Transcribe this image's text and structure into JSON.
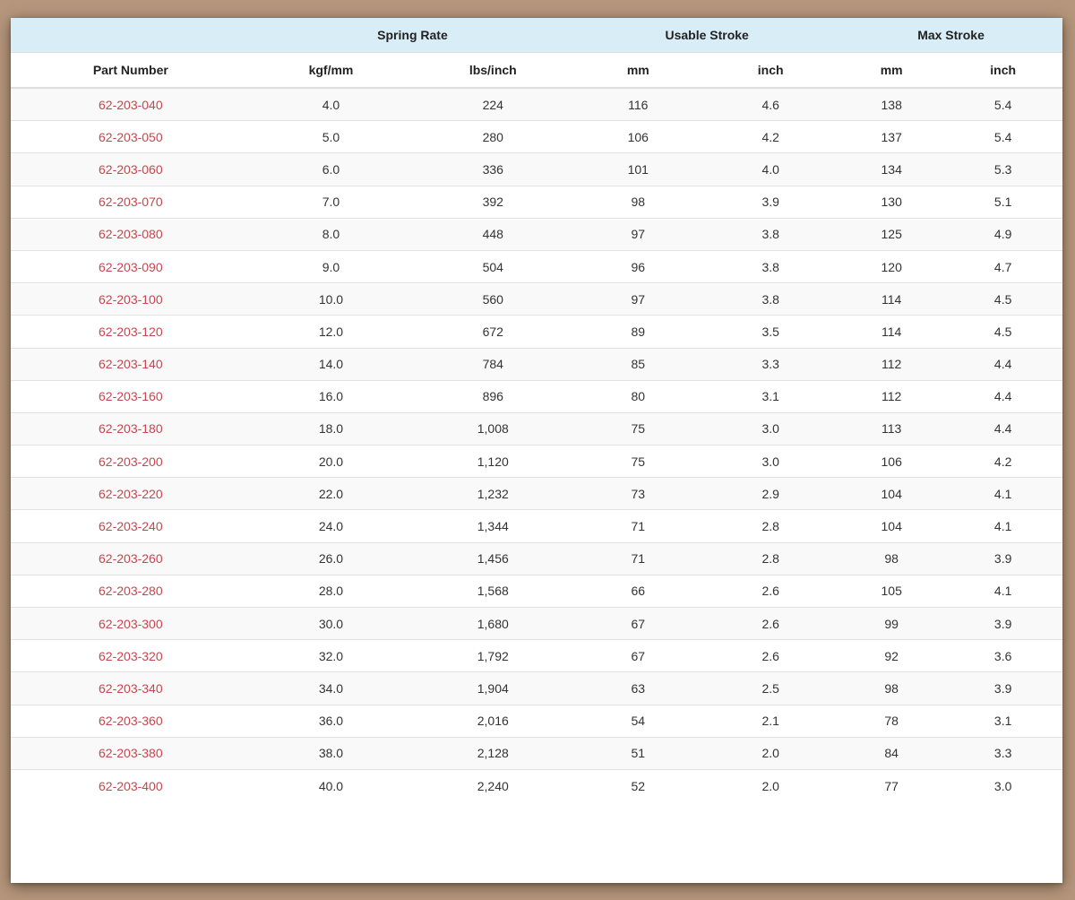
{
  "colors": {
    "page_background": "#b6977d",
    "group_header_bg": "#d9edf7",
    "header_text": "#222222",
    "body_text": "#333333",
    "link_red": "#c7464e",
    "stripe_bg": "#f9f9f9",
    "row_border": "#e2e2e2",
    "head_border": "#dddddd"
  },
  "table": {
    "group_headers": [
      {
        "label": "",
        "colspan": 1
      },
      {
        "label": "Spring Rate",
        "colspan": 2
      },
      {
        "label": "Usable Stroke",
        "colspan": 2
      },
      {
        "label": "Max Stroke",
        "colspan": 2
      }
    ],
    "column_headers": [
      "Part Number",
      "kgf/mm",
      "lbs/inch",
      "mm",
      "inch",
      "mm",
      "inch"
    ],
    "rows": [
      [
        "62-203-040",
        "4.0",
        "224",
        "116",
        "4.6",
        "138",
        "5.4"
      ],
      [
        "62-203-050",
        "5.0",
        "280",
        "106",
        "4.2",
        "137",
        "5.4"
      ],
      [
        "62-203-060",
        "6.0",
        "336",
        "101",
        "4.0",
        "134",
        "5.3"
      ],
      [
        "62-203-070",
        "7.0",
        "392",
        "98",
        "3.9",
        "130",
        "5.1"
      ],
      [
        "62-203-080",
        "8.0",
        "448",
        "97",
        "3.8",
        "125",
        "4.9"
      ],
      [
        "62-203-090",
        "9.0",
        "504",
        "96",
        "3.8",
        "120",
        "4.7"
      ],
      [
        "62-203-100",
        "10.0",
        "560",
        "97",
        "3.8",
        "114",
        "4.5"
      ],
      [
        "62-203-120",
        "12.0",
        "672",
        "89",
        "3.5",
        "114",
        "4.5"
      ],
      [
        "62-203-140",
        "14.0",
        "784",
        "85",
        "3.3",
        "112",
        "4.4"
      ],
      [
        "62-203-160",
        "16.0",
        "896",
        "80",
        "3.1",
        "112",
        "4.4"
      ],
      [
        "62-203-180",
        "18.0",
        "1,008",
        "75",
        "3.0",
        "113",
        "4.4"
      ],
      [
        "62-203-200",
        "20.0",
        "1,120",
        "75",
        "3.0",
        "106",
        "4.2"
      ],
      [
        "62-203-220",
        "22.0",
        "1,232",
        "73",
        "2.9",
        "104",
        "4.1"
      ],
      [
        "62-203-240",
        "24.0",
        "1,344",
        "71",
        "2.8",
        "104",
        "4.1"
      ],
      [
        "62-203-260",
        "26.0",
        "1,456",
        "71",
        "2.8",
        "98",
        "3.9"
      ],
      [
        "62-203-280",
        "28.0",
        "1,568",
        "66",
        "2.6",
        "105",
        "4.1"
      ],
      [
        "62-203-300",
        "30.0",
        "1,680",
        "67",
        "2.6",
        "99",
        "3.9"
      ],
      [
        "62-203-320",
        "32.0",
        "1,792",
        "67",
        "2.6",
        "92",
        "3.6"
      ],
      [
        "62-203-340",
        "34.0",
        "1,904",
        "63",
        "2.5",
        "98",
        "3.9"
      ],
      [
        "62-203-360",
        "36.0",
        "2,016",
        "54",
        "2.1",
        "78",
        "3.1"
      ],
      [
        "62-203-380",
        "38.0",
        "2,128",
        "51",
        "2.0",
        "84",
        "3.3"
      ],
      [
        "62-203-400",
        "40.0",
        "2,240",
        "52",
        "2.0",
        "77",
        "3.0"
      ]
    ]
  }
}
